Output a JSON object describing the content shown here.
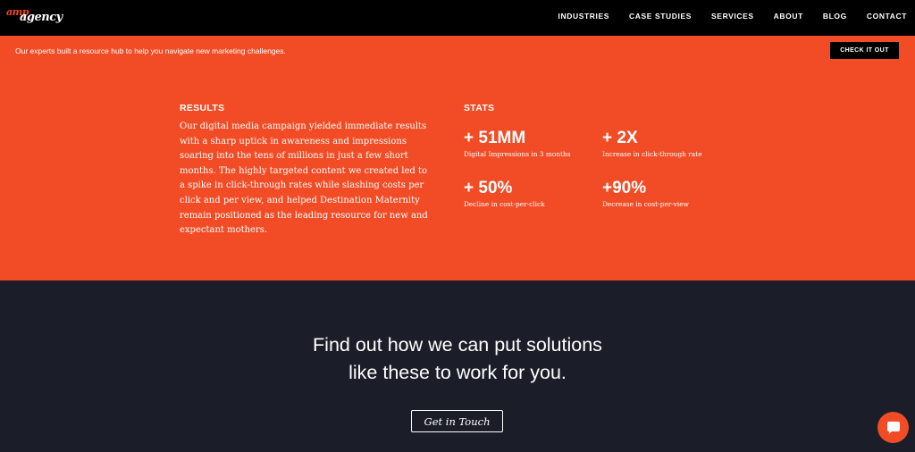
{
  "nav": {
    "logo_top": "amp",
    "logo_bottom": "agency",
    "items": [
      "INDUSTRIES",
      "CASE STUDIES",
      "SERVICES",
      "ABOUT",
      "BLOG",
      "CONTACT"
    ]
  },
  "banner": {
    "text": "Our experts built a resource hub to help you navigate new marketing challenges.",
    "button_label": "CHECK IT OUT"
  },
  "results": {
    "heading": "RESULTS",
    "body": "Our digital media campaign yielded immediate results with a sharp uptick in awareness and impressions soaring into the tens of millions in just a few short months. The highly targeted content we created led to a spike in click-through rates while slashing costs per click and per view, and helped Destination Maternity remain positioned as the leading resource for new and expectant mothers."
  },
  "stats": {
    "heading": "STATS",
    "items": [
      {
        "value": "+ 51MM",
        "label": "Digital Impressions in 3 months"
      },
      {
        "value": "+ 2X",
        "label": "Increase in click-through rate"
      },
      {
        "value": "+ 50%",
        "label": "Decline in cost-per-click"
      },
      {
        "value": "+90%",
        "label": "Decrease in cost-per-view"
      }
    ]
  },
  "cta": {
    "line1": "Find out how we can put solutions",
    "line2": "like these to work for you.",
    "button_label": "Get in Touch"
  },
  "icons": {
    "chat": "chat-bubble-icon"
  },
  "colors": {
    "accent": "#f14c25",
    "nav_bg": "#000000",
    "dark_bg": "#1b1e29"
  }
}
